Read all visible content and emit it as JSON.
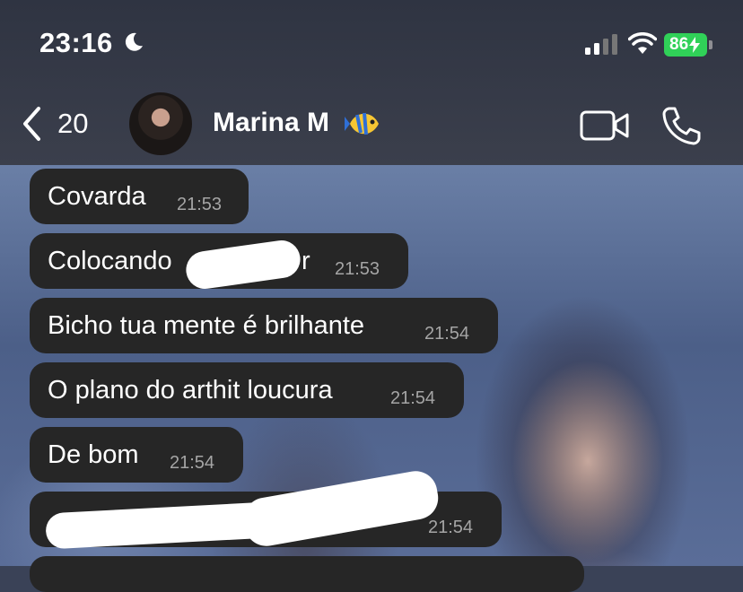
{
  "status_bar": {
    "time": "23:16",
    "battery": "86"
  },
  "header": {
    "back_count": "20",
    "contact_name": "Marina M"
  },
  "messages": [
    {
      "text": "Covarda",
      "time": "21:53"
    },
    {
      "text": "Colocando",
      "text_tail": "r",
      "time": "21:53"
    },
    {
      "text": "Bicho tua mente é brilhante",
      "time": "21:54"
    },
    {
      "text": "O plano do arthit loucura",
      "time": "21:54"
    },
    {
      "text": "De bom",
      "time": "21:54"
    },
    {
      "text": "",
      "time": "21:54"
    }
  ]
}
